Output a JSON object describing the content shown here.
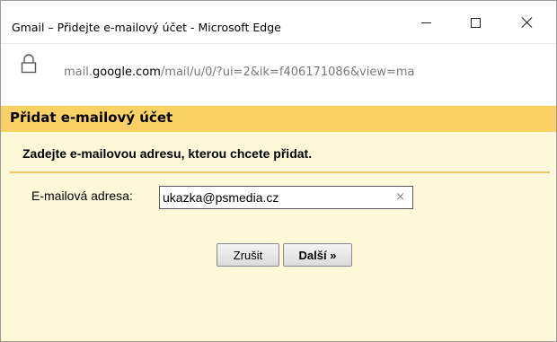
{
  "window": {
    "title": "Gmail – Přidejte e-mailový účet - Microsoft Edge",
    "minimize_icon": "minimize-icon",
    "maximize_icon": "maximize-icon",
    "close_icon": "close-icon"
  },
  "addressbar": {
    "lock_icon": "lock-icon",
    "url_prefix": "mail.",
    "url_domain": "google.com",
    "url_path": "/mail/u/0/?ui=2&ik=f406171086&view=ma"
  },
  "dialog": {
    "title": "Přidat e-mailový účet",
    "prompt": "Zadejte e-mailovou adresu, kterou chcete přidat.",
    "email_label": "E-mailová adresa:",
    "email_value": "ukazka@psmedia.cz",
    "clear_glyph": "×",
    "cancel_label": "Zrušit",
    "next_label": "Další »"
  },
  "colors": {
    "header_band": "#fad164",
    "body_background": "#fff8d9",
    "divider": "#f1c765"
  }
}
